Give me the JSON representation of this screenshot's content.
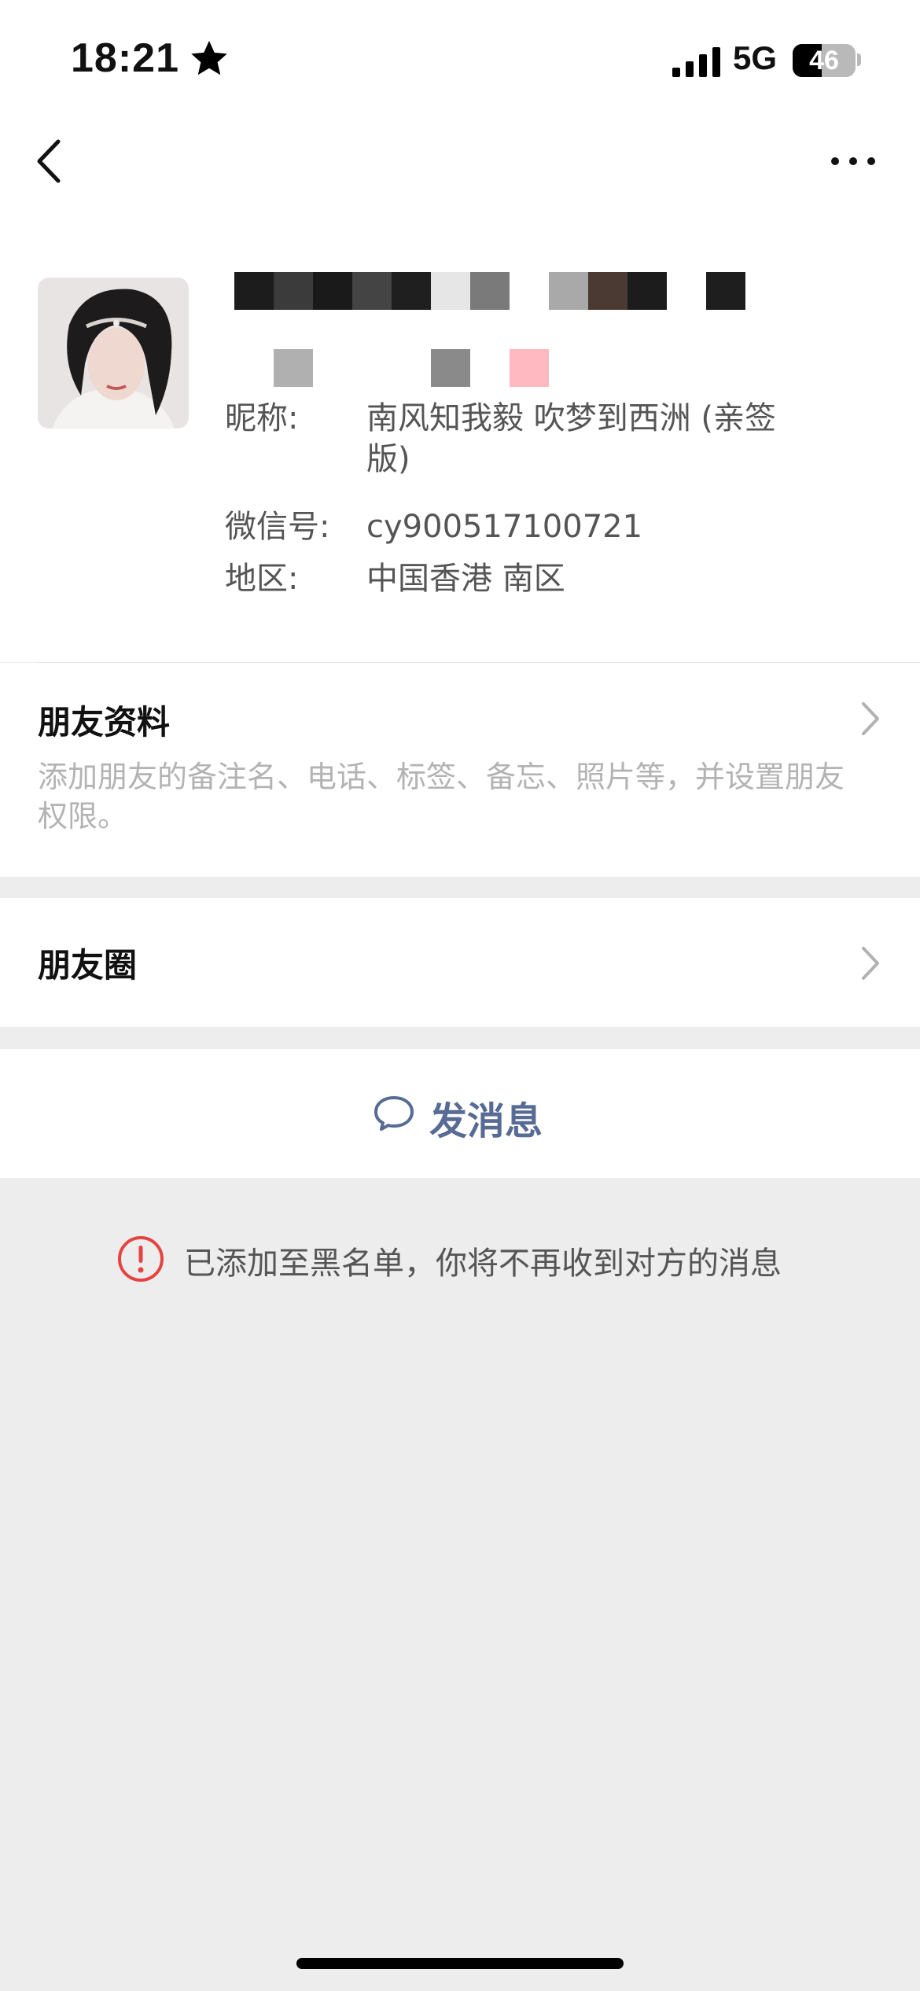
{
  "status_bar": {
    "time": "18:21",
    "network": "5G",
    "battery_level": "46",
    "icons": [
      "star-icon",
      "signal-icon",
      "battery-icon"
    ]
  },
  "nav": {
    "icons": [
      "back-arrow-icon",
      "more-icon"
    ]
  },
  "profile": {
    "nickname_label": "昵称:",
    "nickname_value": "南风知我毅 吹梦到西洲 (亲签版)",
    "wechat_id_label": "微信号:",
    "wechat_id_value": "cy900517100721",
    "region_label": "地区:",
    "region_value": "中国香港 南区"
  },
  "friend_info": {
    "title": "朋友资料",
    "description": "添加朋友的备注名、电话、标签、备忘、照片等，并设置朋友权限。"
  },
  "moments": {
    "title": "朋友圈"
  },
  "send_message": {
    "label": "发消息",
    "accent_color": "#576b95"
  },
  "blacklist_notice": {
    "text": "已添加至黑名单，你将不再收到对方的消息",
    "icon_color": "#e64340"
  }
}
